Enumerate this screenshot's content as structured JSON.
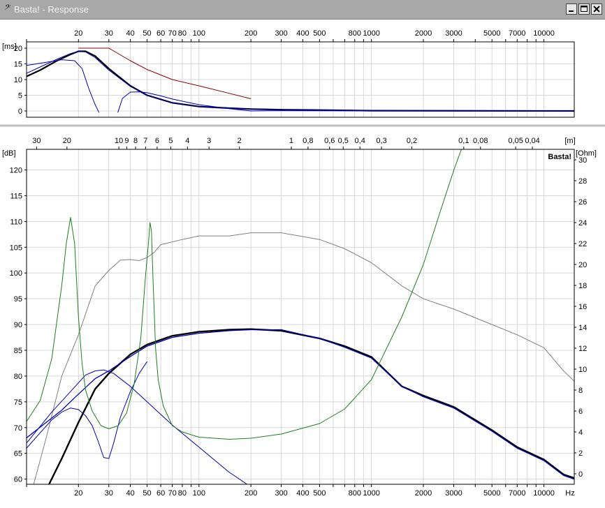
{
  "window": {
    "title": "Basta! - Response",
    "app_icon": "bass-clef-icon"
  },
  "colors": {
    "frame": "#000000",
    "grid": "#d8d8d8",
    "spl": "#000000",
    "driver": "#0000b4",
    "group_delay_limit": "#8b0000",
    "impedance": "#1f7f1f",
    "power": "#808080",
    "window_bg": "#ffffff"
  },
  "chart_data": [
    {
      "type": "line",
      "name": "group_delay",
      "x_scale": "log",
      "xlim": [
        10,
        15000
      ],
      "ylim": [
        -2,
        22
      ],
      "ylabel": "[ms]",
      "x_ticks": [
        20,
        30,
        40,
        50,
        60,
        70,
        80,
        100,
        200,
        300,
        400,
        500,
        800,
        1000,
        2000,
        3000,
        5000,
        7000,
        10000
      ],
      "y_ticks": [
        0,
        5,
        10,
        15,
        20
      ],
      "series": [
        {
          "key": "system",
          "color": "#000000",
          "x": [
            10,
            12,
            15,
            18,
            20,
            22,
            25,
            30,
            40,
            50,
            70,
            100,
            150,
            200,
            300,
            500,
            1000,
            15000
          ],
          "y": [
            11,
            13,
            16,
            18,
            19,
            19,
            17.5,
            13.5,
            8,
            5,
            2.6,
            1.4,
            0.9,
            0.6,
            0.4,
            0.3,
            0.1,
            0
          ]
        },
        {
          "key": "limit",
          "color": "#8b0000",
          "x": [
            20,
            30,
            40,
            50,
            70,
            100,
            150,
            200
          ],
          "y": [
            20,
            20,
            16,
            13.2,
            10,
            8,
            5.6,
            3.9
          ]
        },
        {
          "key": "driver_a",
          "color": "#0000b4",
          "x": [
            10,
            12,
            15,
            18,
            20,
            22,
            25,
            30,
            40,
            50,
            70,
            100,
            200,
            500,
            1000,
            15000
          ],
          "y": [
            12,
            14,
            16.5,
            18.3,
            19,
            18.8,
            17,
            13,
            7.8,
            5,
            2.6,
            1.4,
            0.6,
            0.3,
            0.1,
            0
          ]
        },
        {
          "key": "driver_b",
          "color": "#0000b4",
          "x": [
            10,
            13,
            16,
            19,
            21,
            23,
            25,
            26.3
          ],
          "y": [
            14.5,
            15.5,
            16.3,
            16,
            13.5,
            7,
            2,
            -0.5
          ]
        },
        {
          "key": "driver_c",
          "color": "#0000b4",
          "x": [
            33.8,
            36,
            40,
            45,
            50,
            60,
            70,
            100,
            150,
            200,
            300,
            1000,
            15000
          ],
          "y": [
            -0.5,
            4,
            6,
            6.1,
            5.8,
            4.8,
            3.8,
            2,
            0.7,
            0,
            0.1,
            0,
            0
          ]
        }
      ]
    },
    {
      "type": "line",
      "name": "response",
      "x_scale": "log",
      "xlim": [
        10,
        15000
      ],
      "ylim": [
        59,
        124
      ],
      "y2lim": [
        -1,
        31
      ],
      "ylabel": "[dB]",
      "y2label": "[Ohm]",
      "xunit": "Hz",
      "top_unit": "[m]",
      "watermark": "Basta!",
      "x_ticks": [
        20,
        30,
        40,
        50,
        60,
        70,
        80,
        100,
        200,
        300,
        400,
        500,
        800,
        1000,
        2000,
        3000,
        5000,
        7000,
        10000
      ],
      "y_ticks": [
        60,
        65,
        70,
        75,
        80,
        85,
        90,
        95,
        100,
        105,
        110,
        115,
        120
      ],
      "y2_ticks": [
        0,
        2,
        4,
        6,
        8,
        10,
        12,
        14,
        16,
        18,
        20,
        22,
        24,
        26,
        28,
        30
      ],
      "top_ticks": [
        {
          "label": "30",
          "v": 30
        },
        {
          "label": "20",
          "v": 20
        },
        {
          "label": "10",
          "v": 10
        },
        {
          "label": "9",
          "v": 9
        },
        {
          "label": "8",
          "v": 8
        },
        {
          "label": "7",
          "v": 7
        },
        {
          "label": "6",
          "v": 6
        },
        {
          "label": "5",
          "v": 5
        },
        {
          "label": "4",
          "v": 4
        },
        {
          "label": "3",
          "v": 3
        },
        {
          "label": "2",
          "v": 2
        },
        {
          "label": "1",
          "v": 1
        },
        {
          "label": "0,8",
          "v": 0.8
        },
        {
          "label": "0,6",
          "v": 0.6
        },
        {
          "label": "0,5",
          "v": 0.5
        },
        {
          "label": "0,4",
          "v": 0.4
        },
        {
          "label": "0,3",
          "v": 0.3
        },
        {
          "label": "0,2",
          "v": 0.2
        },
        {
          "label": "0,1",
          "v": 0.1
        },
        {
          "label": "0,08",
          "v": 0.08
        },
        {
          "label": "0,05",
          "v": 0.05
        },
        {
          "label": "0,04",
          "v": 0.04
        }
      ],
      "series": [
        {
          "key": "power",
          "color": "#808080",
          "axis": "left",
          "x": [
            11,
            13,
            16,
            20,
            25,
            30,
            35,
            40,
            45,
            50,
            55,
            60,
            80,
            100,
            150,
            200,
            300,
            500,
            700,
            1000,
            1500,
            2000,
            3000,
            5000,
            7000,
            10000,
            13000,
            15000
          ],
          "y": [
            59,
            68,
            80,
            88,
            97.5,
            100.5,
            102.5,
            102.6,
            102.4,
            103,
            104,
            105.5,
            106.5,
            107.2,
            107.2,
            107.8,
            107.8,
            106.5,
            104.7,
            102,
            97.5,
            95,
            93,
            90,
            88,
            85.5,
            81,
            79
          ]
        },
        {
          "key": "spl",
          "color": "#000000",
          "axis": "left",
          "x": [
            13.5,
            16,
            20,
            25,
            30,
            40,
            50,
            70,
            100,
            150,
            200,
            300,
            500,
            700,
            1000,
            1500,
            2000,
            3000,
            5000,
            7000,
            10000,
            13000,
            15000
          ],
          "y": [
            59,
            64,
            71,
            77.5,
            80.5,
            84.2,
            86.1,
            87.8,
            88.6,
            89,
            89.1,
            88.8,
            87.3,
            85.8,
            83.7,
            78,
            76.2,
            74,
            69.5,
            66.2,
            63.8,
            60.9,
            60.2
          ]
        },
        {
          "key": "driver_a",
          "color": "#0000b4",
          "axis": "left",
          "x": [
            10,
            13,
            16,
            20,
            25,
            30,
            40,
            50,
            70,
            100,
            150,
            200,
            300,
            500,
            700,
            1000,
            1500,
            2000,
            3000,
            5000,
            7000,
            10000,
            13000,
            15000
          ],
          "y": [
            68,
            71,
            73.4,
            76.5,
            79.5,
            81,
            83.8,
            85.8,
            87.5,
            88.3,
            88.8,
            89,
            89,
            87.3,
            85.6,
            83.5,
            78,
            76,
            73.8,
            69.3,
            66,
            63.6,
            60.7,
            60
          ]
        },
        {
          "key": "driver_b",
          "color": "#0000b4",
          "axis": "left",
          "x": [
            10,
            12,
            14,
            16,
            18,
            20,
            22,
            24,
            26,
            28,
            30,
            32,
            35,
            40,
            45,
            50
          ],
          "y": [
            66,
            69,
            71.5,
            73,
            73.8,
            73.5,
            72.3,
            70.4,
            67.4,
            64.2,
            64,
            67,
            72,
            77,
            80.5,
            82.8
          ]
        },
        {
          "key": "driver_c",
          "color": "#0000b4",
          "axis": "left",
          "x": [
            10,
            14,
            18,
            22,
            25,
            28,
            32,
            40,
            50,
            70,
            100,
            150,
            200
          ],
          "y": [
            67,
            73,
            77,
            80.2,
            81,
            81.2,
            80.5,
            78,
            75,
            70.5,
            66.2,
            61.3,
            58.5
          ]
        },
        {
          "key": "impedance",
          "color": "#1f7f1f",
          "axis": "right",
          "x": [
            10,
            12,
            14,
            16,
            17,
            18,
            19,
            20,
            21,
            22,
            24,
            27,
            30,
            34,
            38,
            42,
            46,
            49,
            51,
            52,
            53,
            54,
            56,
            58,
            62,
            70,
            80,
            100,
            150,
            200,
            300,
            500,
            700,
            1000,
            1500,
            2000,
            2500,
            3000,
            3500
          ],
          "y": [
            5,
            7,
            11,
            18,
            22,
            24.5,
            22,
            15,
            10.5,
            8,
            6,
            4.6,
            4.3,
            4.6,
            5.8,
            8.5,
            13,
            19,
            22.2,
            24,
            23.2,
            19,
            12,
            9,
            6.5,
            4.6,
            4,
            3.5,
            3.3,
            3.4,
            3.8,
            4.8,
            6.2,
            9,
            15,
            20,
            25,
            29,
            32
          ]
        }
      ]
    }
  ]
}
